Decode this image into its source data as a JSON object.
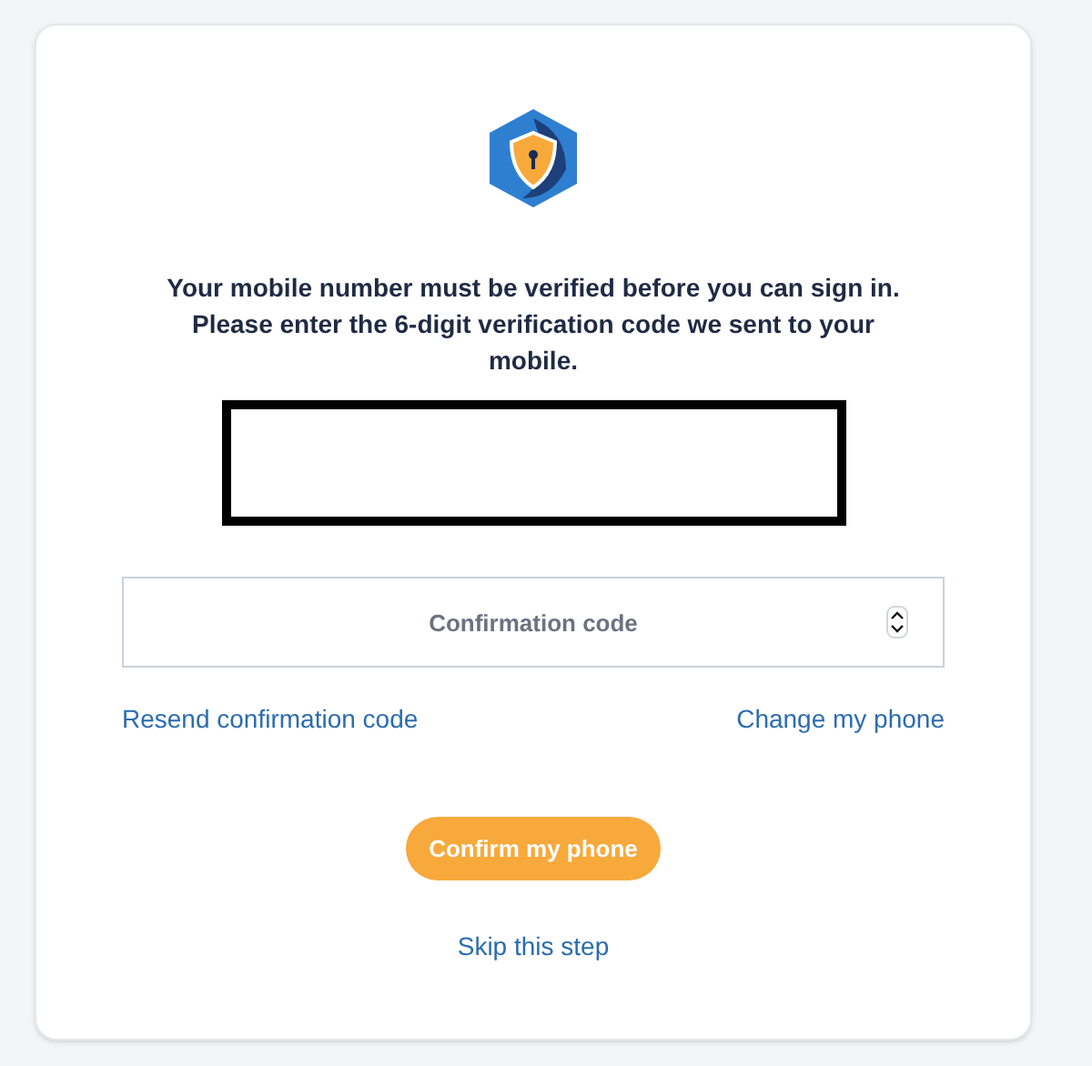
{
  "message": "Your mobile number must be verified before you can sign in. Please enter the 6-digit verification code we sent to your mobile.",
  "code_field": {
    "placeholder": "Confirmation code"
  },
  "links": [
    "Resend confirmation code",
    "Change my phone"
  ],
  "confirm_button": "Confirm my phone",
  "skip_link": "Skip this step"
}
